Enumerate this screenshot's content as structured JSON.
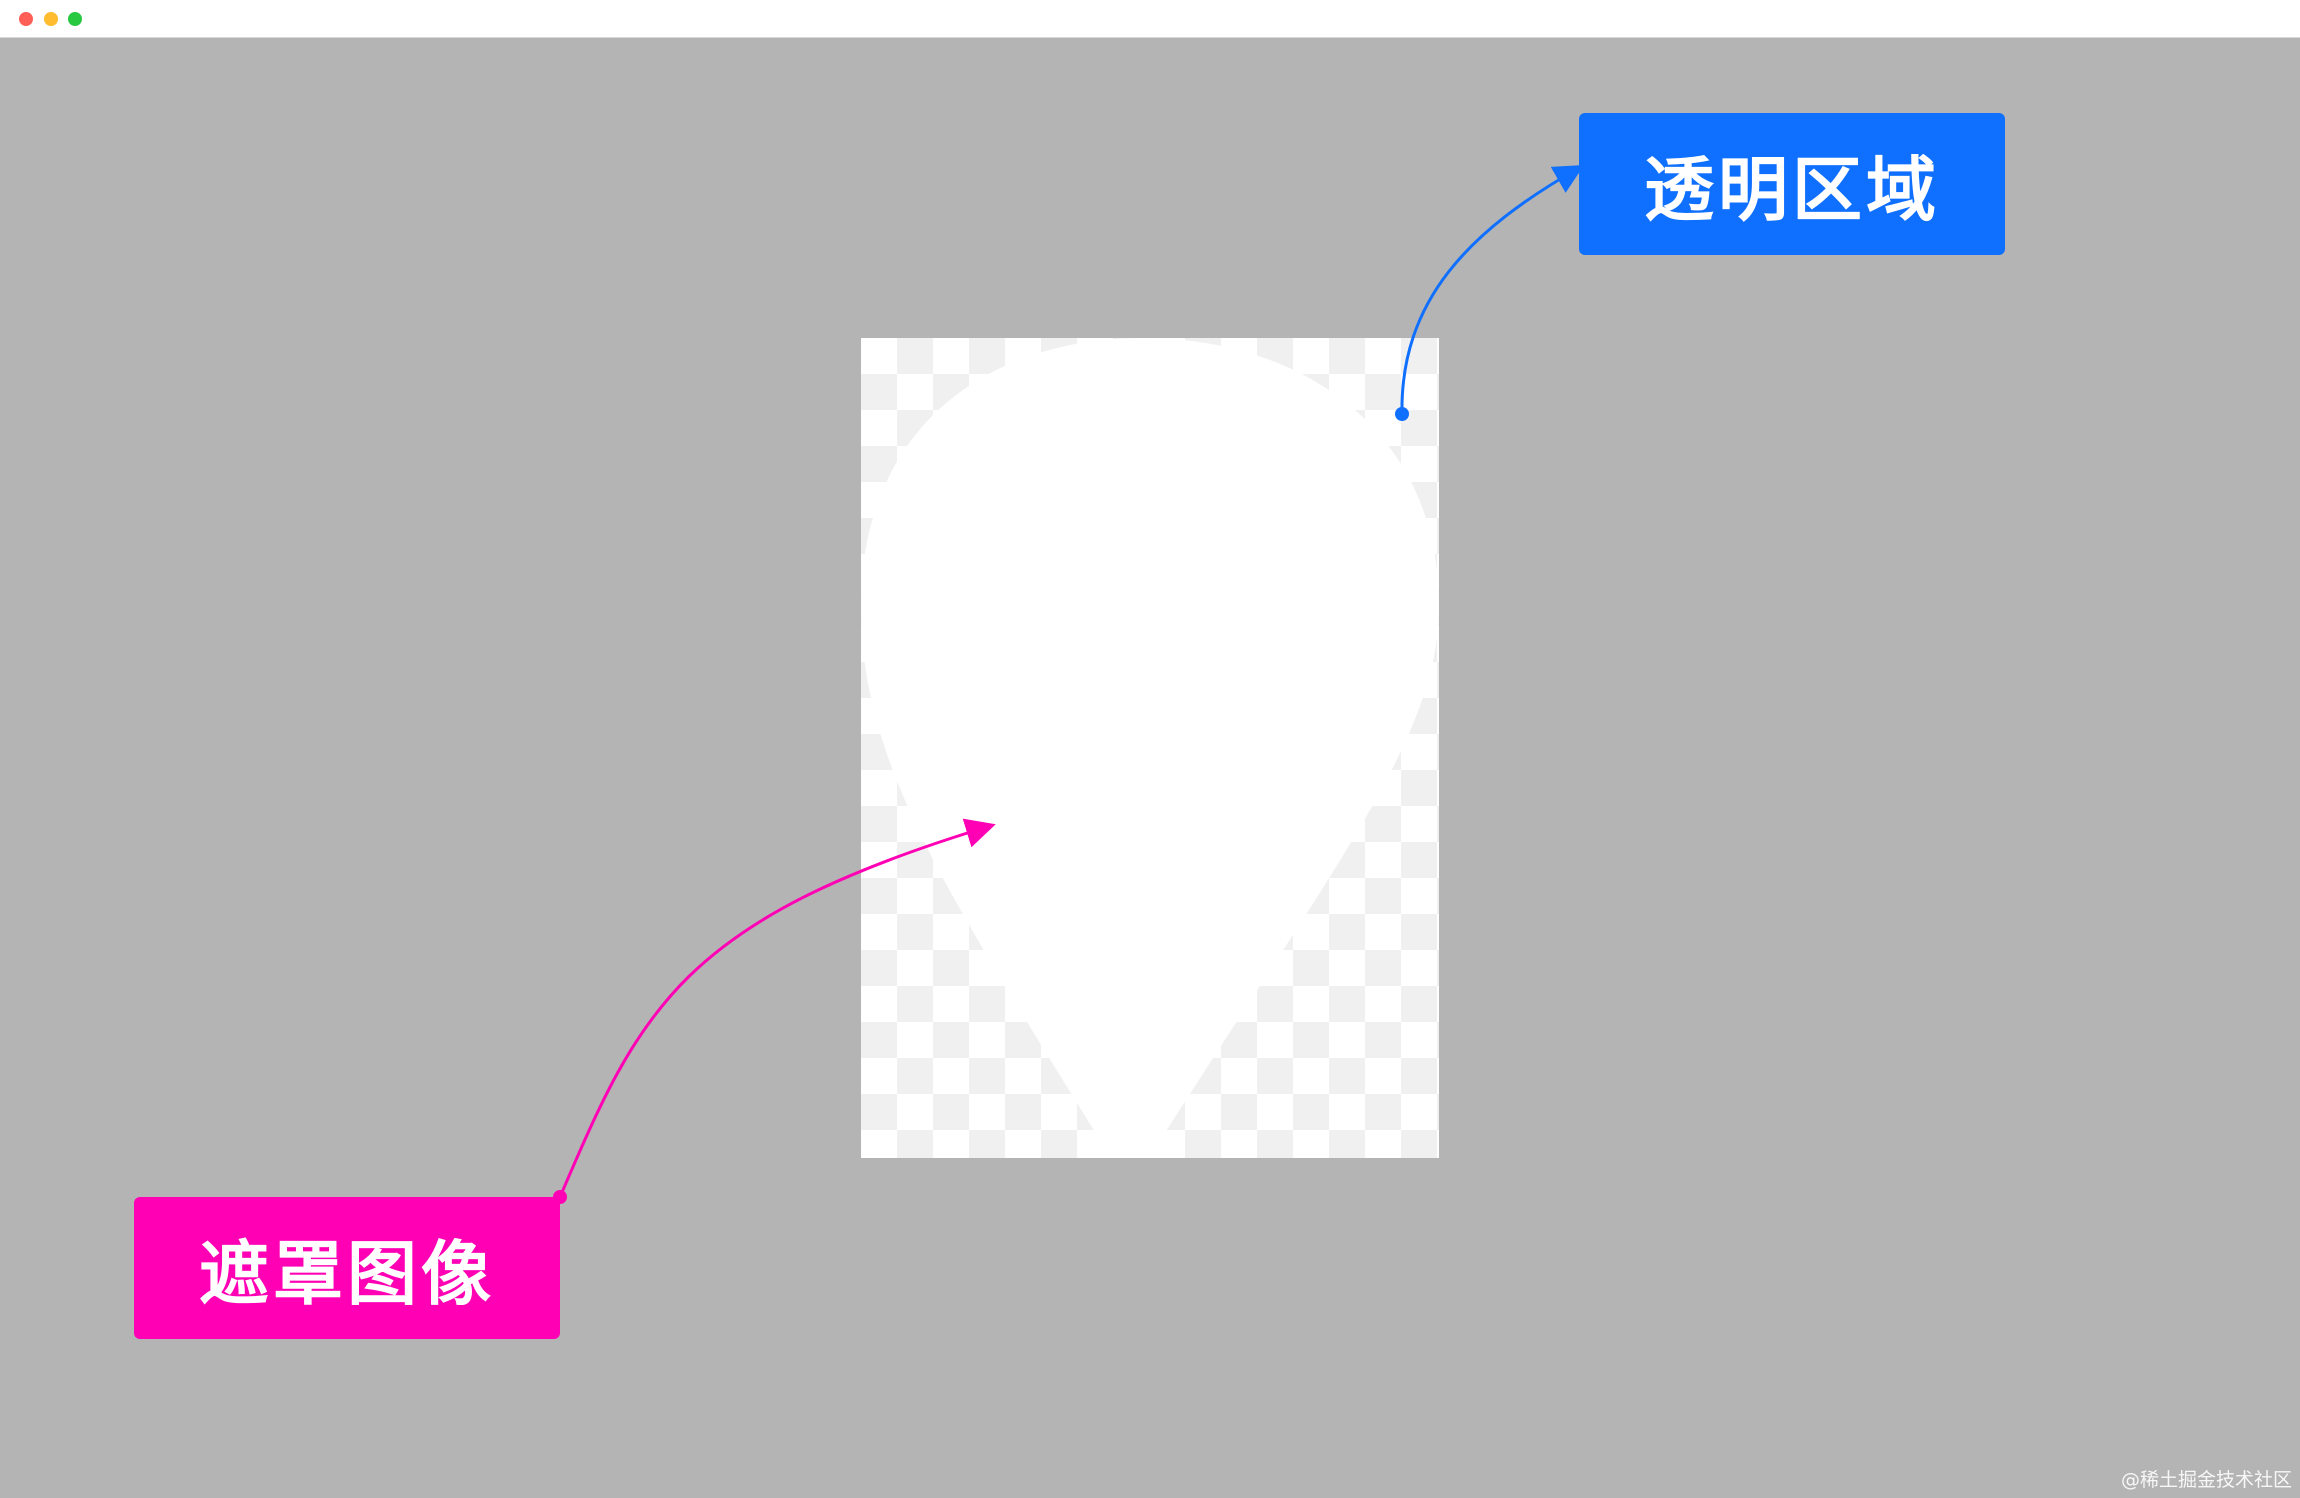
{
  "window": {
    "controls": [
      "close",
      "minimize",
      "maximize"
    ]
  },
  "colors": {
    "background": "#b4b4b4",
    "transparent_label": "#0f6fff",
    "mask_label": "#ff00b4",
    "checker": "#f0f0f0",
    "mask_shape": "#ffffff"
  },
  "labels": {
    "transparent_area": "透明区域",
    "mask_image": "遮罩图像"
  },
  "icons": {
    "mask_shape": "map-pin-shape"
  },
  "watermark": "@稀土掘金技术社区"
}
